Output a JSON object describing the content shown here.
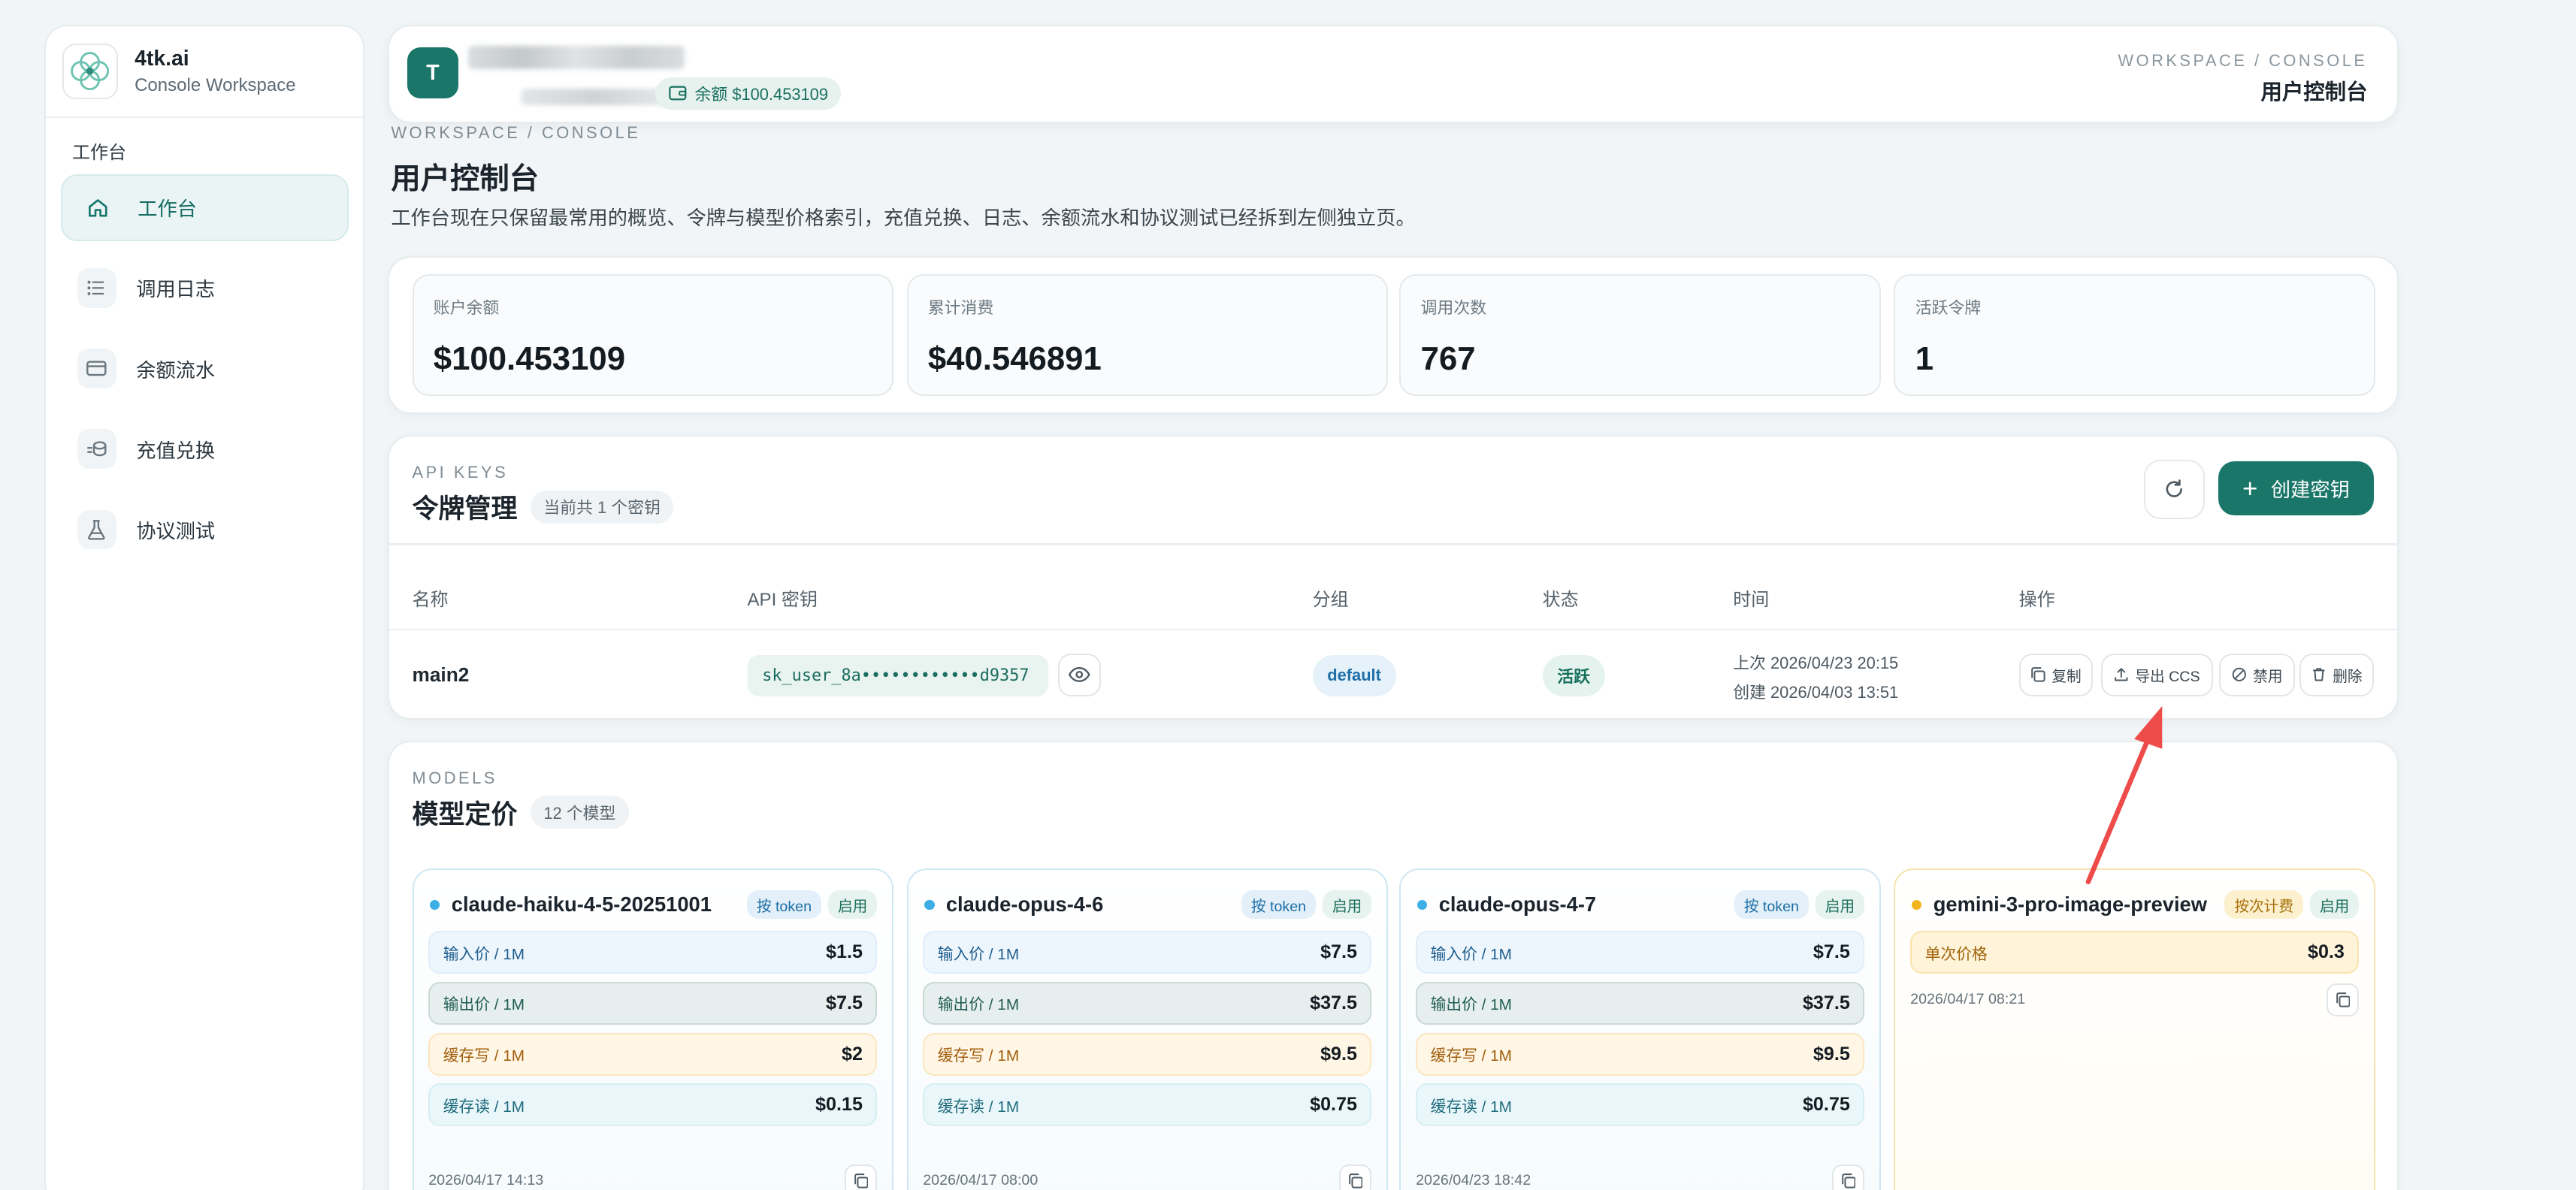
{
  "brand": {
    "name": "4tk.ai",
    "subtitle": "Console Workspace"
  },
  "sidebar": {
    "section": "工作台",
    "items": [
      {
        "label": "工作台",
        "icon": "home-icon",
        "active": true
      },
      {
        "label": "调用日志",
        "icon": "list-icon"
      },
      {
        "label": "余额流水",
        "icon": "card-icon"
      },
      {
        "label": "充值兑换",
        "icon": "coins-icon"
      },
      {
        "label": "协议测试",
        "icon": "flask-icon"
      }
    ]
  },
  "topbar": {
    "avatar_letter": "T",
    "balance_chip": "余额 $100.453109",
    "crumb": "WORKSPACE / CONSOLE",
    "title": "用户控制台"
  },
  "header": {
    "crumb": "WORKSPACE / CONSOLE",
    "title": "用户控制台",
    "description": "工作台现在只保留最常用的概览、令牌与模型价格索引，充值兑换、日志、余额流水和协议测试已经拆到左侧独立页。"
  },
  "stats": [
    {
      "label": "账户余额",
      "value": "$100.453109"
    },
    {
      "label": "累计消费",
      "value": "$40.546891"
    },
    {
      "label": "调用次数",
      "value": "767"
    },
    {
      "label": "活跃令牌",
      "value": "1"
    }
  ],
  "keys": {
    "kicker": "API KEYS",
    "title": "令牌管理",
    "count": "当前共 1 个密钥",
    "create_label": "创建密钥",
    "columns": [
      "名称",
      "API 密钥",
      "分组",
      "状态",
      "时间",
      "操作"
    ],
    "rows": [
      {
        "name": "main2",
        "key": "sk_user_8a••••••••••••d9357",
        "group": "default",
        "status": "活跃",
        "last_used": "上次 2026/04/23 20:15",
        "created": "创建 2026/04/03 13:51",
        "actions": {
          "copy": "复制",
          "export": "导出 CCS",
          "disable": "禁用",
          "delete": "删除"
        }
      }
    ]
  },
  "models": {
    "kicker": "MODELS",
    "title": "模型定价",
    "count": "12 个模型",
    "cards": [
      {
        "name": "claude-haiku-4-5-20251001",
        "billing": "按 token",
        "status": "启用",
        "date": "2026/04/17 14:13",
        "prices": [
          {
            "label": "输入价 / 1M",
            "value": "$1.5"
          },
          {
            "label": "输出价 / 1M",
            "value": "$7.5"
          },
          {
            "label": "缓存写 / 1M",
            "value": "$2"
          },
          {
            "label": "缓存读 / 1M",
            "value": "$0.15"
          }
        ]
      },
      {
        "name": "claude-opus-4-6",
        "billing": "按 token",
        "status": "启用",
        "date": "2026/04/17 08:00",
        "prices": [
          {
            "label": "输入价 / 1M",
            "value": "$7.5"
          },
          {
            "label": "输出价 / 1M",
            "value": "$37.5"
          },
          {
            "label": "缓存写 / 1M",
            "value": "$9.5"
          },
          {
            "label": "缓存读 / 1M",
            "value": "$0.75"
          }
        ]
      },
      {
        "name": "claude-opus-4-7",
        "billing": "按 token",
        "status": "启用",
        "date": "2026/04/23 18:42",
        "prices": [
          {
            "label": "输入价 / 1M",
            "value": "$7.5"
          },
          {
            "label": "输出价 / 1M",
            "value": "$37.5"
          },
          {
            "label": "缓存写 / 1M",
            "value": "$9.5"
          },
          {
            "label": "缓存读 / 1M",
            "value": "$0.75"
          }
        ]
      },
      {
        "name": "gemini-3-pro-image-preview",
        "billing": "按次计费",
        "status": "启用",
        "date": "2026/04/17 08:21",
        "prices": [
          {
            "label": "单次价格",
            "value": "$0.3"
          }
        ]
      }
    ]
  },
  "colors": {
    "accent": "#1a7668",
    "annotation_arrow": "#ee4b4b"
  }
}
